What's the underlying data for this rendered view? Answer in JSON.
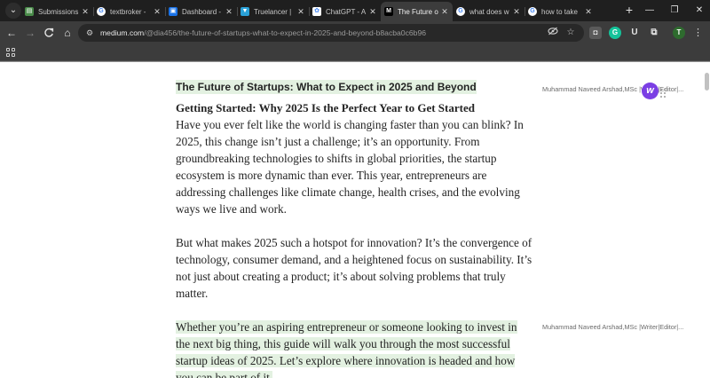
{
  "tabs": [
    {
      "title": "Submissions",
      "favicon": "submissions-icon",
      "color": "#4a8c4a",
      "glyph": "▤"
    },
    {
      "title": "textbroker -",
      "favicon": "google-icon",
      "color": "#ffffff",
      "glyph": "G"
    },
    {
      "title": "Dashboard -",
      "favicon": "dashboard-icon",
      "color": "#1a73e8",
      "glyph": "▣"
    },
    {
      "title": "Truelancer |",
      "favicon": "truelancer-icon",
      "color": "#2aa1d8",
      "glyph": "▼"
    },
    {
      "title": "ChatGPT - A",
      "favicon": "chatgpt-icon",
      "color": "#ffffff",
      "glyph": "✿"
    },
    {
      "title": "The Future o",
      "favicon": "medium-icon",
      "color": "#000000",
      "glyph": "M",
      "active": true
    },
    {
      "title": "what does w",
      "favicon": "google-icon",
      "color": "#ffffff",
      "glyph": "G"
    },
    {
      "title": "how to take",
      "favicon": "google-icon",
      "color": "#ffffff",
      "glyph": "G"
    }
  ],
  "window_controls": {
    "minimize": "—",
    "restore": "❐",
    "close": "✕"
  },
  "toolbar": {
    "back": "←",
    "forward": "→",
    "reload": "C",
    "home": "⌂",
    "url_host": "medium.com",
    "url_path": "/@dia456/the-future-of-startups-what-to-expect-in-2025-and-beyond-b8acba0c6b96",
    "profile_initial": "T",
    "extensions": [
      {
        "name": "screen-capture-extension-icon",
        "glyph": "◘",
        "color": "#5a5a5a"
      },
      {
        "name": "grammarly-extension-icon",
        "glyph": "G",
        "color": "#15c39a"
      },
      {
        "name": "u-extension-icon",
        "glyph": "U",
        "color": "#3c3c3c"
      },
      {
        "name": "extensions-puzzle-icon",
        "glyph": "⧉",
        "color": "#3c3c3c"
      }
    ]
  },
  "article": {
    "title": "The Future of Startups: What to Expect in 2025 and Beyond",
    "subheading": "Getting Started: Why 2025 Is the Perfect Year to Get Started",
    "paragraph1": "Have you ever felt like the world is changing faster than you can blink? In 2025, this change isn’t just a challenge; it’s an opportunity. From groundbreaking technologies to shifts in global priorities, the startup ecosystem is more dynamic than ever. This year, entrepreneurs are addressing challenges like climate change, health crises, and the evolving ways we live and work.",
    "paragraph2": "But what makes 2025 such a hotspot for innovation? It’s the convergence of technology, consumer demand, and a heightened focus on sustainability. It’s not just about creating a product; it’s about solving problems that truly matter.",
    "paragraph3": "Whether you’re an aspiring entrepreneur or someone looking to invest in the next big thing, this guide will walk you through the most successful startup ideas of 2025. Let’s explore where innovation is headed and how you can be part of it."
  },
  "side_notes": {
    "author_1": "Muhammad Naveed Arshad,MSc |Writer|Editor|...",
    "author_2": "Muhammad Naveed Arshad,MSc |Writer|Editor|...",
    "badge_letter": "w"
  },
  "colors": {
    "highlight": "#e3f1e1",
    "badge": "#7b3fe4"
  }
}
